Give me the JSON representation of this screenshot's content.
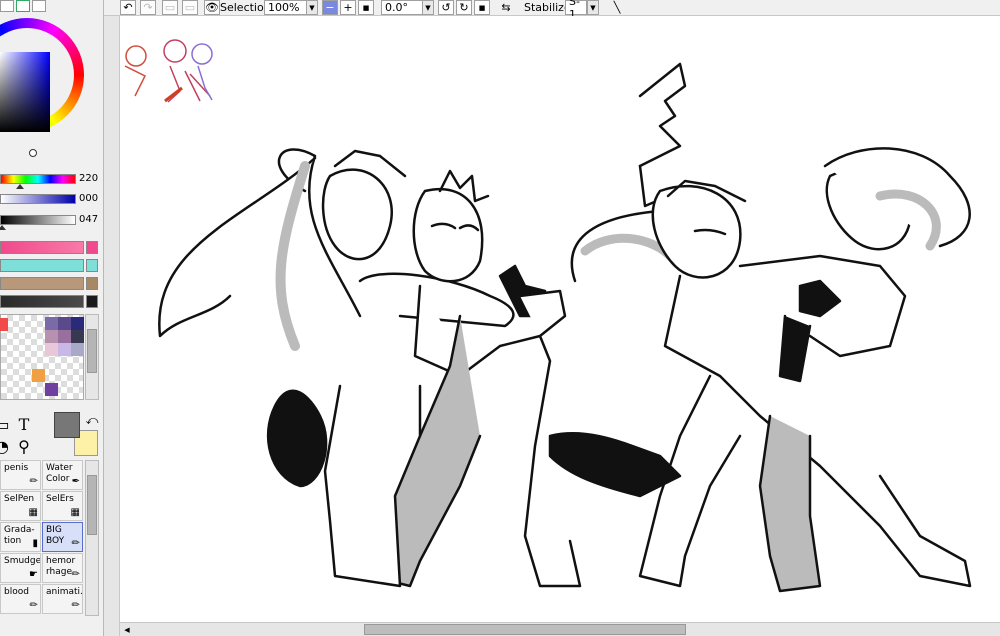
{
  "toolbar": {
    "selection_label": "Selection",
    "zoom_value": "100%",
    "rotation_value": "0.0°",
    "stabilizer_label": "Stabilizer",
    "stabilizer_value": "S-1"
  },
  "color_sliders": [
    {
      "value": "220",
      "gradient": "linear-gradient(to right,#000,#0000ff)",
      "marker": 0.86
    },
    {
      "value": "000",
      "gradient": "linear-gradient(to right,#000080,#000080)",
      "marker": 0.0
    },
    {
      "value": "047",
      "gradient": "linear-gradient(to right,#000,#fff)",
      "marker": 0.18
    }
  ],
  "palette_bars": [
    {
      "color": "#f04a8c",
      "end": "#f04a8c"
    },
    {
      "color": "#7ddfd8",
      "end": "#7ddfd8"
    },
    {
      "color": "#b8987a",
      "end": "#a88864"
    },
    {
      "color": "#3a3a3a",
      "end": "#1a1a1a"
    }
  ],
  "swatches": [
    "#f04a4a",
    "#7a6aa8",
    "#5a4a8a",
    "#2a2a7a",
    "#b890b0",
    "#9870a0",
    "#c8b8e8",
    "#383850",
    "#e8c8d8",
    "#a8a8c8",
    "#f0a040",
    "#7040a0"
  ],
  "brushes": [
    {
      "name": "penis",
      "icon": "✏"
    },
    {
      "name": "Water Color",
      "icon": "✒"
    },
    {
      "name": "SelPen",
      "icon": "▦"
    },
    {
      "name": "SelErs",
      "icon": "▦"
    },
    {
      "name": "Grada-tion",
      "icon": "▮"
    },
    {
      "name": "BIG BOY",
      "icon": "✏"
    },
    {
      "name": "Smudge",
      "icon": "☛"
    },
    {
      "name": "hemor rhage",
      "icon": "✏"
    },
    {
      "name": "blood",
      "icon": "✏"
    },
    {
      "name": "animati...",
      "icon": "✏"
    }
  ],
  "tools": {
    "text_icon": "T"
  },
  "canvas": {
    "background": "#ffffff"
  }
}
